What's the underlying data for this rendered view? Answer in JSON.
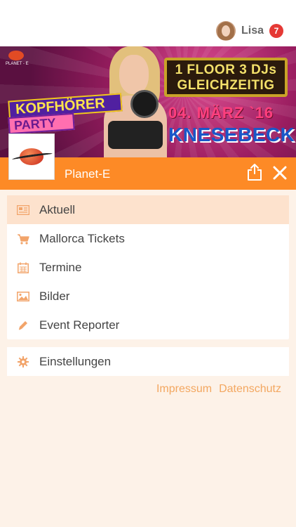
{
  "header": {
    "username": "Lisa",
    "notification_count": "7"
  },
  "banner": {
    "brand_small": "PLANET - E",
    "headline_line1": "1 FLOOR 3 DJs",
    "headline_line2": "GLEICHZEITIG",
    "event_date": "04. MÄRZ `16",
    "event_place": "KNESEBECK",
    "title_top": "KOPFHÖRER",
    "title_bottom": "PARTY"
  },
  "app_bar": {
    "title": "Planet-E",
    "accent_color": "#fd8a26"
  },
  "menu": {
    "items": [
      {
        "label": "Aktuell",
        "icon": "newspaper-icon",
        "active": true
      },
      {
        "label": "Mallorca Tickets",
        "icon": "cart-icon"
      },
      {
        "label": "Termine",
        "icon": "calendar-icon"
      },
      {
        "label": "Bilder",
        "icon": "image-icon"
      },
      {
        "label": "Event Reporter",
        "icon": "pencil-icon"
      }
    ],
    "settings": {
      "label": "Einstellungen",
      "icon": "gear-icon"
    }
  },
  "footer_links": {
    "impressum": "Impressum",
    "datenschutz": "Datenschutz"
  }
}
